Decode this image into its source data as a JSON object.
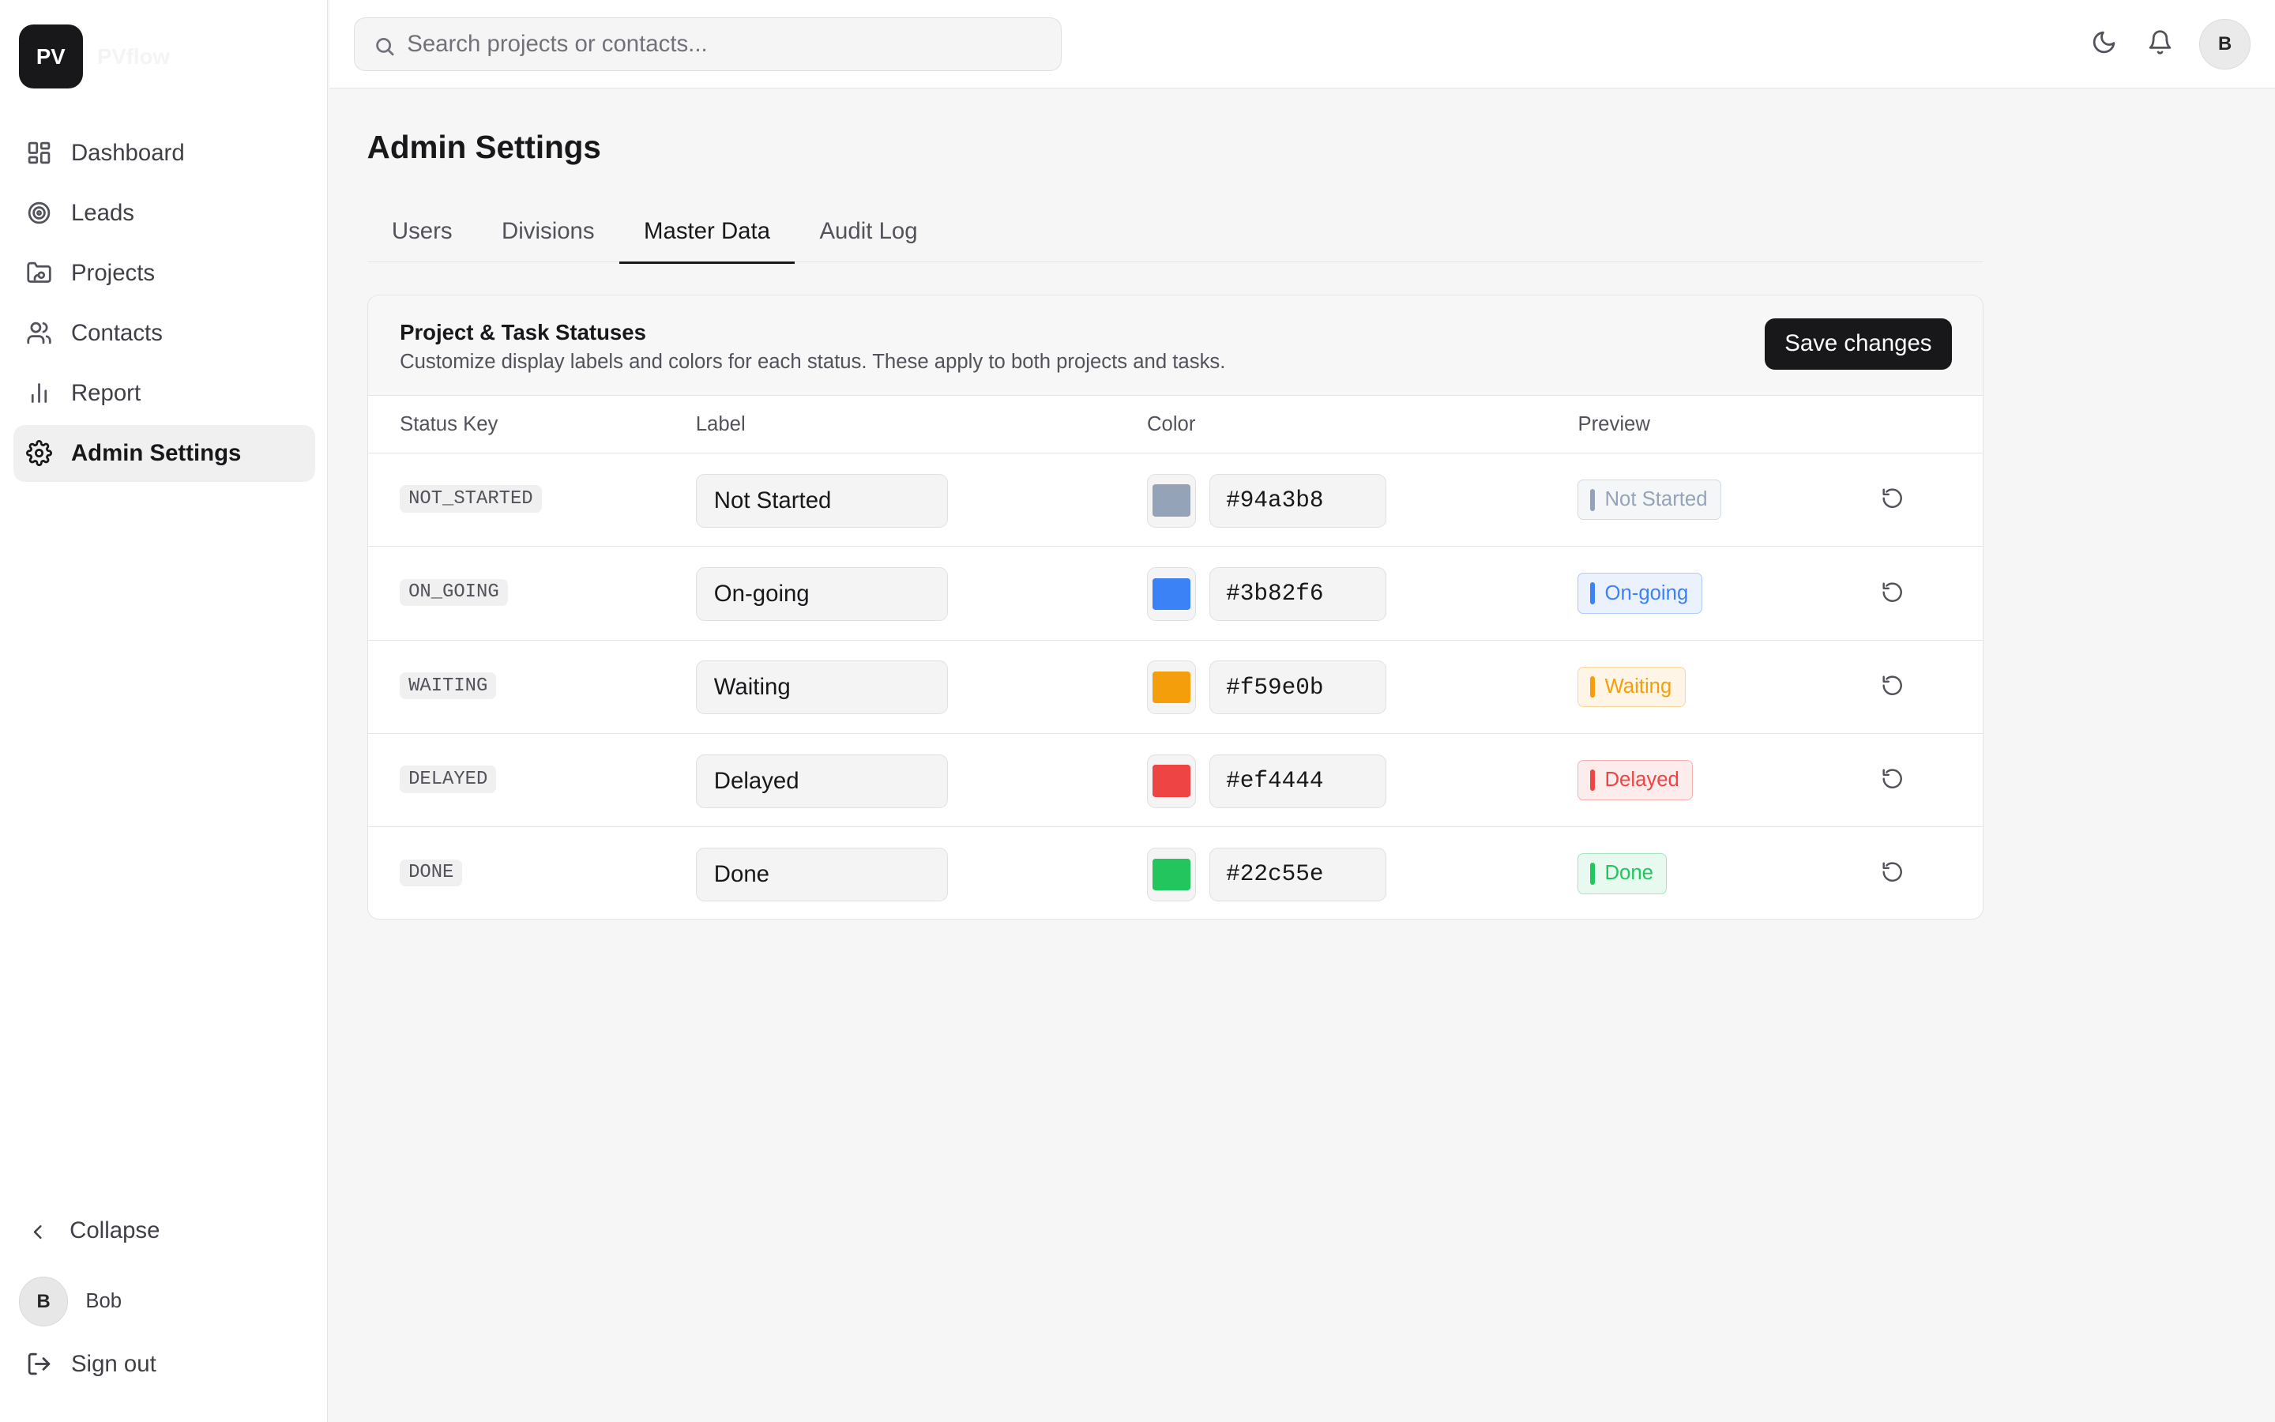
{
  "brand": {
    "initials": "PV",
    "name": "PVflow"
  },
  "sidebar": {
    "items": [
      {
        "label": "Dashboard",
        "icon": "dashboard-icon",
        "active": false
      },
      {
        "label": "Leads",
        "icon": "target-icon",
        "active": false
      },
      {
        "label": "Projects",
        "icon": "folder-icon",
        "active": false
      },
      {
        "label": "Contacts",
        "icon": "users-icon",
        "active": false
      },
      {
        "label": "Report",
        "icon": "bar-chart-icon",
        "active": false
      },
      {
        "label": "Admin Settings",
        "icon": "gear-icon",
        "active": true
      }
    ],
    "collapse_label": "Collapse",
    "user": {
      "initial": "B",
      "name": "Bob"
    },
    "signout_label": "Sign out"
  },
  "header": {
    "search_placeholder": "Search projects or contacts...",
    "avatar_initial": "B"
  },
  "page": {
    "title": "Admin Settings",
    "tabs": [
      {
        "label": "Users",
        "active": false
      },
      {
        "label": "Divisions",
        "active": false
      },
      {
        "label": "Master Data",
        "active": true
      },
      {
        "label": "Audit Log",
        "active": false
      }
    ]
  },
  "statuses": {
    "title": "Project & Task Statuses",
    "subtitle": "Customize display labels and colors for each status. These apply to both projects and tasks.",
    "save_label": "Save changes",
    "columns": {
      "key": "Status Key",
      "label": "Label",
      "color": "Color",
      "preview": "Preview"
    },
    "rows": [
      {
        "key": "NOT_STARTED",
        "label": "Not Started",
        "color": "#94a3b8"
      },
      {
        "key": "ON_GOING",
        "label": "On-going",
        "color": "#3b82f6"
      },
      {
        "key": "WAITING",
        "label": "Waiting",
        "color": "#f59e0b"
      },
      {
        "key": "DELAYED",
        "label": "Delayed",
        "color": "#ef4444"
      },
      {
        "key": "DONE",
        "label": "Done",
        "color": "#22c55e"
      }
    ]
  }
}
